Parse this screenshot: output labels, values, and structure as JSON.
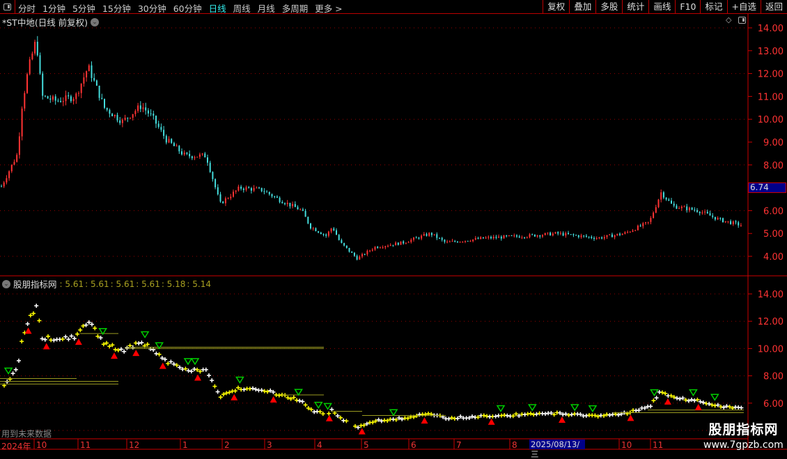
{
  "toolbar": {
    "periods": [
      "分时",
      "1分钟",
      "5分钟",
      "15分钟",
      "30分钟",
      "60分钟",
      "日线",
      "周线",
      "月线",
      "多周期",
      "更多 >"
    ],
    "active": "日线",
    "buttons": [
      "复权",
      "叠加",
      "多股",
      "统计",
      "画线",
      "F10",
      "标记",
      "+自选",
      "返回"
    ]
  },
  "main": {
    "title": "*ST中地(日线 前复权)",
    "current_price": "6.74"
  },
  "indicator": {
    "name": "股朋指标网",
    "values": [
      ": 5.61",
      ": 5.61",
      ": 5.61",
      ": 5.61",
      ": 5.18",
      ": 5.14"
    ],
    "note": "用到未来数据"
  },
  "date_axis": {
    "labels": [
      "2024年",
      "10",
      "11",
      "12",
      "1",
      "2",
      "3",
      "4",
      "5",
      "6",
      "7",
      "8",
      "10",
      "11"
    ],
    "cursor_date": "2025/08/13/三"
  },
  "watermark": {
    "title": "股朋指标网",
    "url": "www.7gpzb.com"
  },
  "colors": {
    "up": "#ff3333",
    "down": "#44dddd",
    "axis": "#cc0000",
    "accent": "#33eeee",
    "signal_buy": "#ff0000",
    "signal_sell": "#00cc00"
  },
  "chart_data": [
    {
      "type": "candlestick",
      "title": "*ST中地(日线 前复权)",
      "y_ticks": [
        "14.00",
        "13.00",
        "12.00",
        "11.00",
        "10.00",
        "9.00",
        "8.00",
        "6.00",
        "5.00",
        "4.00"
      ],
      "ylim": [
        3.6,
        14.3
      ],
      "grid": "dotted",
      "close_trend": [
        [
          "2024-09-05",
          7.1
        ],
        [
          "2024-09-17",
          8.5
        ],
        [
          "2024-09-20",
          10.5
        ],
        [
          "2024-09-25",
          12.2
        ],
        [
          "2024-10-01",
          13.5
        ],
        [
          "2024-10-05",
          11
        ],
        [
          "2024-10-15",
          10.8
        ],
        [
          "2024-10-28",
          11
        ],
        [
          "2024-11-06",
          12.3
        ],
        [
          "2024-11-16",
          10.5
        ],
        [
          "2024-11-27",
          9.9
        ],
        [
          "2024-12-08",
          10.6
        ],
        [
          "2024-12-14",
          10.1
        ],
        [
          "2024-12-22",
          9.1
        ],
        [
          "2025-01-03",
          8.4
        ],
        [
          "2025-01-18",
          8.4
        ],
        [
          "2025-01-28",
          6.3
        ],
        [
          "2025-02-12",
          7.0
        ],
        [
          "2025-02-28",
          6.9
        ],
        [
          "2025-03-08",
          6.5
        ],
        [
          "2025-03-22",
          6.0
        ],
        [
          "2025-03-27",
          5.3
        ],
        [
          "2025-04-07",
          4.9
        ],
        [
          "2025-04-11",
          5.3
        ],
        [
          "2025-04-16",
          4.6
        ],
        [
          "2025-04-27",
          3.9
        ],
        [
          "2025-05-08",
          4.4
        ],
        [
          "2025-05-26",
          4.6
        ],
        [
          "2025-06-14",
          5.0
        ],
        [
          "2025-06-24",
          4.6
        ],
        [
          "2025-07-17",
          4.8
        ],
        [
          "2025-08-10",
          4.9
        ],
        [
          "2025-08-25",
          5.0
        ],
        [
          "2025-09-18",
          4.8
        ],
        [
          "2025-10-04",
          5.0
        ],
        [
          "2025-10-28",
          5.5
        ],
        [
          "2025-11-06",
          6.8
        ],
        [
          "2025-11-13",
          6.2
        ],
        [
          "2025-11-28",
          6.0
        ],
        [
          "2025-12-11",
          5.6
        ],
        [
          "2025-12-25",
          5.35
        ]
      ]
    },
    {
      "type": "scatter",
      "title": "股朋指标网",
      "y_ticks": [
        "14.00",
        "12.00",
        "10.00",
        "8.00",
        "6.00"
      ],
      "ylim": [
        4.7,
        14.5
      ],
      "buy_signals": [
        "2024-09-25",
        "2024-10-08",
        "2024-10-30",
        "2024-11-22",
        "2024-12-05",
        "2024-12-20",
        "2025-01-12",
        "2025-02-08",
        "2025-03-05",
        "2025-04-09",
        "2025-04-30",
        "2025-06-10",
        "2025-07-20",
        "2025-08-28",
        "2025-10-10",
        "2025-11-10",
        "2025-11-28"
      ],
      "sell_signals": [
        "2024-09-10",
        "2024-11-15",
        "2024-12-10",
        "2024-12-18",
        "2025-01-05",
        "2025-01-10",
        "2025-02-12",
        "2025-03-20",
        "2025-04-02",
        "2025-04-08",
        "2025-05-20",
        "2025-07-25",
        "2025-08-12",
        "2025-09-05",
        "2025-09-15",
        "2025-11-02",
        "2025-11-25",
        "2025-12-08"
      ]
    }
  ]
}
